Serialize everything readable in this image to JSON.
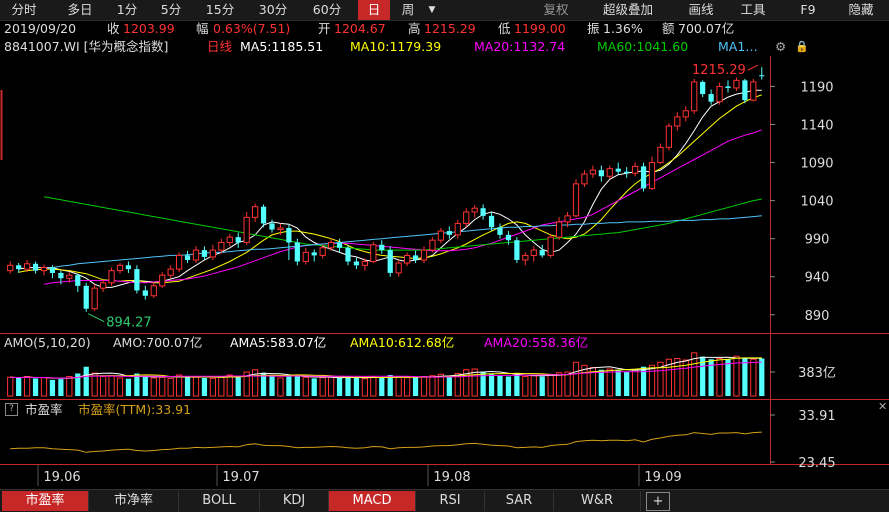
{
  "toolbar": {
    "periods": [
      "分时",
      "多日",
      "1分",
      "5分",
      "15分",
      "30分",
      "60分",
      "日",
      "周"
    ],
    "active_period": "日",
    "right": [
      "复权",
      "超级叠加",
      "画线",
      "工具",
      "F9",
      "隐藏"
    ]
  },
  "quote": {
    "date": "2019/09/20",
    "close_label": "收",
    "close": "1203.99",
    "change_label": "幅",
    "change": "0.63%(7.51)",
    "open_label": "开",
    "open": "1204.67",
    "high_label": "高",
    "high": "1215.29",
    "low_label": "低",
    "low": "1199.00",
    "amp_label": "振",
    "amp": "1.36%",
    "amount_label": "额",
    "amount": "700.07亿"
  },
  "ma_bar": {
    "code": "8841007.WI [华为概念指数]",
    "period": "日线",
    "ma5": "MA5:1185.51",
    "ma10": "MA10:1179.39",
    "ma20": "MA20:1132.74",
    "ma60": "MA60:1041.60",
    "ma_more": "MA1…"
  },
  "price_axis": {
    "labels": [
      "1190",
      "1140",
      "1090",
      "1040",
      "990",
      "940",
      "890"
    ],
    "values": [
      1190,
      1140,
      1090,
      1040,
      990,
      940,
      890
    ]
  },
  "annotations": {
    "max_label": "1215.29",
    "min_label": "894.27"
  },
  "amo_bar": {
    "name": "AMO(5,10,20)",
    "amo": "AMO:700.07亿",
    "ama5": "AMA5:583.07亿",
    "ama10": "AMA10:612.68亿",
    "ama20": "AMA20:558.36亿",
    "axis_label": "383亿"
  },
  "pe_bar": {
    "help": "?",
    "name": "市盈率",
    "value": "市盈率(TTM):33.91",
    "axis_top": "33.91",
    "axis_bottom": "23.45"
  },
  "date_axis": [
    "19.06",
    "19.07",
    "19.08",
    "19.09"
  ],
  "bottom_tabs": [
    "市盈率",
    "市净率",
    "BOLL",
    "KDJ",
    "MACD",
    "RSI",
    "SAR",
    "W&R",
    "+"
  ],
  "bottom_active": [
    "市盈率",
    "MACD"
  ],
  "colors": {
    "up": "#ff3232",
    "down": "#54ffff",
    "ma5": "#ffffff",
    "ma10": "#ffff00",
    "ma20": "#ff00ff",
    "ma60": "#00cc00",
    "ma120": "#4fc3f7",
    "pe_line": "#d4a017"
  },
  "chart_data": {
    "type": "candlestick",
    "candles": [
      [
        948,
        955,
        960,
        944
      ],
      [
        955,
        950,
        958,
        945
      ],
      [
        950,
        957,
        962,
        946
      ],
      [
        957,
        948,
        960,
        944
      ],
      [
        948,
        952,
        956,
        942
      ],
      [
        952,
        945,
        955,
        938
      ],
      [
        945,
        938,
        948,
        930
      ],
      [
        938,
        942,
        946,
        932
      ],
      [
        942,
        928,
        944,
        920
      ],
      [
        928,
        898,
        932,
        894
      ],
      [
        898,
        925,
        930,
        895
      ],
      [
        925,
        932,
        936,
        920
      ],
      [
        932,
        948,
        952,
        928
      ],
      [
        948,
        955,
        958,
        944
      ],
      [
        955,
        950,
        960,
        945
      ],
      [
        950,
        922,
        955,
        918
      ],
      [
        922,
        915,
        928,
        910
      ],
      [
        915,
        928,
        932,
        912
      ],
      [
        928,
        942,
        946,
        925
      ],
      [
        942,
        950,
        955,
        938
      ],
      [
        950,
        968,
        972,
        946
      ],
      [
        968,
        962,
        974,
        958
      ],
      [
        962,
        975,
        980,
        958
      ],
      [
        975,
        966,
        980,
        962
      ],
      [
        966,
        975,
        982,
        962
      ],
      [
        975,
        985,
        990,
        970
      ],
      [
        985,
        992,
        996,
        980
      ],
      [
        992,
        985,
        998,
        978
      ],
      [
        985,
        1018,
        1025,
        982
      ],
      [
        1018,
        1032,
        1036,
        1012
      ],
      [
        1032,
        1010,
        1035,
        1005
      ],
      [
        1010,
        1002,
        1015,
        998
      ],
      [
        1002,
        1004,
        1010,
        995
      ],
      [
        1004,
        985,
        1008,
        962
      ],
      [
        985,
        960,
        990,
        955
      ],
      [
        960,
        972,
        978,
        956
      ],
      [
        972,
        968,
        976,
        960
      ],
      [
        968,
        978,
        982,
        964
      ],
      [
        978,
        985,
        990,
        974
      ],
      [
        985,
        978,
        990,
        972
      ],
      [
        978,
        960,
        982,
        955
      ],
      [
        960,
        955,
        965,
        950
      ],
      [
        955,
        960,
        964,
        948
      ],
      [
        960,
        982,
        986,
        958
      ],
      [
        982,
        975,
        988,
        970
      ],
      [
        975,
        945,
        980,
        940
      ],
      [
        945,
        958,
        962,
        940
      ],
      [
        958,
        968,
        972,
        954
      ],
      [
        968,
        962,
        974,
        958
      ],
      [
        962,
        975,
        980,
        958
      ],
      [
        975,
        988,
        992,
        972
      ],
      [
        988,
        1000,
        1004,
        984
      ],
      [
        1000,
        995,
        1006,
        990
      ],
      [
        995,
        1010,
        1015,
        990
      ],
      [
        1010,
        1025,
        1030,
        1005
      ],
      [
        1025,
        1030,
        1034,
        1018
      ],
      [
        1030,
        1020,
        1035,
        1015
      ],
      [
        1020,
        1005,
        1025,
        1000
      ],
      [
        1005,
        995,
        1010,
        990
      ],
      [
        995,
        988,
        1000,
        982
      ],
      [
        988,
        962,
        992,
        958
      ],
      [
        962,
        968,
        972,
        955
      ],
      [
        968,
        975,
        980,
        960
      ],
      [
        975,
        968,
        982,
        965
      ],
      [
        968,
        992,
        996,
        965
      ],
      [
        992,
        1012,
        1018,
        988
      ],
      [
        1012,
        1020,
        1025,
        1005
      ],
      [
        1020,
        1062,
        1068,
        1018
      ],
      [
        1062,
        1075,
        1080,
        1058
      ],
      [
        1075,
        1080,
        1086,
        1070
      ],
      [
        1080,
        1072,
        1086,
        1065
      ],
      [
        1072,
        1082,
        1086,
        1068
      ],
      [
        1082,
        1078,
        1090,
        1074
      ],
      [
        1078,
        1076,
        1084,
        1070
      ],
      [
        1076,
        1085,
        1090,
        1072
      ],
      [
        1085,
        1056,
        1090,
        1052
      ],
      [
        1056,
        1090,
        1098,
        1054
      ],
      [
        1090,
        1110,
        1115,
        1088
      ],
      [
        1110,
        1138,
        1142,
        1106
      ],
      [
        1138,
        1150,
        1156,
        1132
      ],
      [
        1150,
        1158,
        1164,
        1144
      ],
      [
        1158,
        1196,
        1200,
        1154
      ],
      [
        1196,
        1180,
        1198,
        1176
      ],
      [
        1180,
        1170,
        1186,
        1166
      ],
      [
        1170,
        1190,
        1195,
        1166
      ],
      [
        1190,
        1188,
        1198,
        1182
      ],
      [
        1188,
        1198,
        1202,
        1184
      ],
      [
        1198,
        1172,
        1200,
        1168
      ],
      [
        1172,
        1196,
        1200,
        1170
      ],
      [
        1204.67,
        1203.99,
        1215.29,
        1199
      ]
    ],
    "ma_series": {
      "MA5": [
        950,
        952,
        952,
        952,
        952,
        949,
        947,
        943,
        938,
        930,
        926,
        926,
        929,
        932,
        935,
        934,
        933,
        934,
        937,
        940,
        948,
        955,
        962,
        968,
        972,
        978,
        985,
        988,
        995,
        1008,
        1012,
        1010,
        1009,
        1004,
        992,
        985,
        980,
        976,
        972,
        968,
        966,
        962,
        960,
        963,
        966,
        962,
        960,
        962,
        964,
        968,
        978,
        988,
        997,
        1005,
        1015,
        1022,
        1025,
        1022,
        1016,
        1008,
        995,
        985,
        976,
        972,
        975,
        985,
        996,
        1012,
        1035,
        1055,
        1068,
        1074,
        1076,
        1078,
        1079,
        1077,
        1080,
        1088,
        1100,
        1115,
        1132,
        1150,
        1164,
        1170,
        1176,
        1180,
        1182,
        1185,
        1185
      ],
      "MA10": [
        946,
        948,
        949,
        950,
        950,
        949,
        948,
        946,
        944,
        940,
        936,
        935,
        934,
        935,
        935,
        933,
        932,
        932,
        933,
        934,
        938,
        942,
        946,
        950,
        955,
        960,
        966,
        972,
        980,
        988,
        995,
        998,
        1000,
        1000,
        998,
        996,
        993,
        990,
        986,
        981,
        976,
        973,
        970,
        968,
        967,
        966,
        965,
        964,
        965,
        967,
        970,
        974,
        978,
        983,
        989,
        995,
        1000,
        1005,
        1010,
        1012,
        1010,
        1005,
        1000,
        995,
        992,
        990,
        992,
        996,
        1005,
        1015,
        1028,
        1040,
        1052,
        1062,
        1070,
        1076,
        1082,
        1090,
        1098,
        1108,
        1118,
        1128,
        1138,
        1148,
        1156,
        1164,
        1170,
        1175,
        1179
      ],
      "MA20": [
        930,
        932,
        933,
        934,
        935,
        935,
        935,
        935,
        935,
        934,
        933,
        932,
        932,
        933,
        934,
        935,
        936,
        937,
        939,
        941,
        944,
        947,
        950,
        953,
        957,
        961,
        965,
        969,
        973,
        976,
        979,
        981,
        982,
        983,
        984,
        984,
        984,
        983,
        982,
        981,
        980,
        979,
        978,
        977,
        976,
        975,
        974,
        974,
        974,
        975,
        976,
        978,
        981,
        984,
        988,
        992,
        996,
        1000,
        1004,
        1008,
        1010,
        1012,
        1014,
        1016,
        1018,
        1022,
        1028,
        1034,
        1040,
        1046,
        1052,
        1058,
        1064,
        1070,
        1076,
        1082,
        1088,
        1094,
        1100,
        1106,
        1112,
        1118,
        1122,
        1126,
        1129,
        1133
      ],
      "MA60": [
        1045,
        1043,
        1041,
        1039,
        1037,
        1035,
        1033,
        1031,
        1029,
        1027,
        1025,
        1023,
        1021,
        1019,
        1017,
        1015,
        1013,
        1011,
        1009,
        1007,
        1005,
        1003,
        1001,
        999,
        997,
        995,
        993,
        991,
        989,
        987,
        985,
        983,
        982,
        981,
        980,
        979,
        978,
        977,
        976,
        975,
        975,
        975,
        975,
        975,
        975,
        975,
        976,
        977,
        978,
        979,
        980,
        981,
        982,
        983,
        984,
        985,
        986,
        987,
        988,
        989,
        990,
        991,
        992,
        993,
        994,
        995,
        996,
        997,
        998,
        1000,
        1002,
        1004,
        1006,
        1008,
        1010,
        1013,
        1016,
        1019,
        1022,
        1025,
        1028,
        1031,
        1034,
        1037,
        1040,
        1042
      ],
      "MA120": [
        950,
        952,
        954,
        955,
        957,
        958,
        959,
        960,
        961,
        962,
        963,
        964,
        965,
        966,
        967,
        968,
        968,
        969,
        970,
        971,
        972,
        972,
        973,
        974,
        975,
        976,
        976,
        977,
        978,
        979,
        980,
        981,
        982,
        983,
        984,
        985,
        986,
        987,
        988,
        989,
        990,
        991,
        992,
        993,
        994,
        995,
        996,
        997,
        998,
        999,
        1000,
        1001,
        1002,
        1003,
        1004,
        1005,
        1005,
        1006,
        1006,
        1007,
        1007,
        1008,
        1008,
        1009,
        1009,
        1010,
        1010,
        1011,
        1011,
        1012,
        1012,
        1012,
        1013,
        1013,
        1013,
        1014,
        1014,
        1014,
        1015,
        1015,
        1016,
        1016,
        1017,
        1018,
        1019,
        1020
      ]
    },
    "amo": [
      500,
      480,
      520,
      470,
      490,
      430,
      450,
      520,
      600,
      780,
      610,
      520,
      540,
      480,
      460,
      600,
      520,
      480,
      500,
      470,
      560,
      520,
      500,
      480,
      470,
      520,
      560,
      500,
      640,
      700,
      620,
      520,
      480,
      520,
      560,
      500,
      470,
      490,
      500,
      480,
      520,
      480,
      460,
      520,
      480,
      560,
      500,
      490,
      500,
      520,
      540,
      580,
      540,
      600,
      700,
      720,
      640,
      600,
      540,
      520,
      600,
      520,
      540,
      520,
      560,
      620,
      640,
      900,
      820,
      760,
      700,
      720,
      680,
      640,
      700,
      780,
      820,
      900,
      980,
      1000,
      960,
      1150,
      1050,
      980,
      1000,
      980,
      1060,
      1000,
      980,
      1000
    ],
    "pe_ttm": [
      26.4,
      26.5,
      26.5,
      26.6,
      26.6,
      26.4,
      26.3,
      26.2,
      26.1,
      25.6,
      25.8,
      25.9,
      26.1,
      26.2,
      26.3,
      26.0,
      25.9,
      26.0,
      26.2,
      26.3,
      26.5,
      26.5,
      26.7,
      26.6,
      26.7,
      26.8,
      26.9,
      26.8,
      27.3,
      27.5,
      27.2,
      27.1,
      27.1,
      26.9,
      26.6,
      26.7,
      26.7,
      26.8,
      26.9,
      26.8,
      26.6,
      26.5,
      26.6,
      26.9,
      26.8,
      26.4,
      26.6,
      26.7,
      26.7,
      26.8,
      27.0,
      27.1,
      27.1,
      27.3,
      27.5,
      27.6,
      27.4,
      27.2,
      27.1,
      27.0,
      26.6,
      26.7,
      26.8,
      26.7,
      27.1,
      27.3,
      27.4,
      28.0,
      28.2,
      28.3,
      28.2,
      28.3,
      28.3,
      28.2,
      28.4,
      27.9,
      28.5,
      28.8,
      29.2,
      29.4,
      29.5,
      30.0,
      29.8,
      29.6,
      29.9,
      29.9,
      30.0,
      29.7,
      30.0,
      30.1
    ],
    "pe_axis": [
      33.91,
      23.45
    ],
    "price_range": [
      870,
      1230
    ]
  }
}
